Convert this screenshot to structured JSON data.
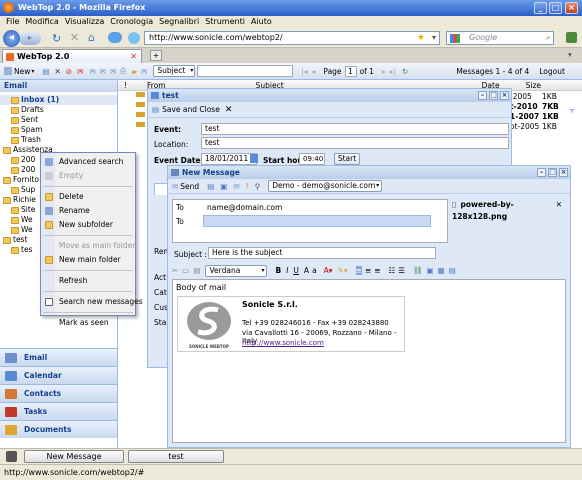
{
  "browser": {
    "title": "WebTop 2.0 - Mozilla Firefox",
    "menu": [
      "File",
      "Modifica",
      "Visualizza",
      "Cronologia",
      "Segnalibri",
      "Strumenti",
      "Aiuto"
    ],
    "url": "http://www.sonicle.com/webtop2/",
    "search_placeholder": "Google",
    "tab_label": "WebTop 2.0",
    "status_url": "http://www.sonicle.com/webtop2/#"
  },
  "toolbar": {
    "new_label": "New",
    "filter_value": "Subject",
    "page_label": "Page",
    "page_value": "1",
    "page_of": "of 1",
    "messages_info": "Messages 1 - 4 of 4",
    "logout_label": "Logout"
  },
  "sidebar": {
    "header": "Email",
    "tree": [
      {
        "label": "Inbox (1)",
        "indent": 1,
        "bold": true,
        "selected": true
      },
      {
        "label": "Drafts",
        "indent": 1
      },
      {
        "label": "Sent",
        "indent": 1
      },
      {
        "label": "Spam",
        "indent": 1
      },
      {
        "label": "Trash",
        "indent": 1
      },
      {
        "label": "Assistenza",
        "indent": 0
      },
      {
        "label": "200",
        "indent": 1
      },
      {
        "label": "200",
        "indent": 1
      },
      {
        "label": "Fornito",
        "indent": 0
      },
      {
        "label": "Sup",
        "indent": 1
      },
      {
        "label": "Richie",
        "indent": 0
      },
      {
        "label": "Site",
        "indent": 1
      },
      {
        "label": "We",
        "indent": 1
      },
      {
        "label": "We",
        "indent": 1
      },
      {
        "label": "test",
        "indent": 0
      },
      {
        "label": "tes",
        "indent": 1
      }
    ],
    "nav": [
      {
        "label": "Email",
        "icon": "email-icon",
        "color": "#6b8fd1"
      },
      {
        "label": "Calendar",
        "icon": "calendar-icon",
        "color": "#5b8bd6"
      },
      {
        "label": "Contacts",
        "icon": "contacts-icon",
        "color": "#d07a3a"
      },
      {
        "label": "Tasks",
        "icon": "tasks-icon",
        "color": "#c0392b"
      },
      {
        "label": "Documents",
        "icon": "documents-icon",
        "color": "#e0a730"
      }
    ]
  },
  "context_menu": {
    "items": [
      {
        "label": "Advanced search",
        "disabled": false,
        "icon": "search-icon"
      },
      {
        "label": "Empty",
        "disabled": true,
        "icon": "empty-icon"
      },
      {
        "sep": true
      },
      {
        "label": "Delete",
        "disabled": false,
        "icon": "folder-delete-icon"
      },
      {
        "label": "Rename",
        "disabled": false,
        "icon": "rename-icon"
      },
      {
        "label": "New subfolder",
        "disabled": false,
        "icon": "folder-add-icon"
      },
      {
        "sep": true
      },
      {
        "label": "Move as main folder",
        "disabled": true,
        "icon": ""
      },
      {
        "label": "New main folder",
        "disabled": false,
        "icon": "folder-icon"
      },
      {
        "sep": true
      },
      {
        "label": "Refresh",
        "disabled": false,
        "icon": ""
      },
      {
        "sep": true
      },
      {
        "label": "Search new messages",
        "disabled": false,
        "icon": "checkbox-icon"
      },
      {
        "sep": true
      },
      {
        "label": "Mark as seen",
        "disabled": false,
        "icon": ""
      }
    ]
  },
  "grid": {
    "col_from": "From",
    "col_subject": "Subject",
    "col_date": "Date",
    "col_size": "Size",
    "rows": [
      {
        "date": "-2005",
        "size": "1KB"
      },
      {
        "date": "t-2010",
        "size": "7KB"
      },
      {
        "date": "1-2007",
        "size": "1KB"
      },
      {
        "date": "ot-2005",
        "size": "1KB"
      }
    ]
  },
  "event_window": {
    "title": "test",
    "save_label": "Save and Close",
    "event_label": "Event:",
    "event_value": "test",
    "location_label": "Location:",
    "location_value": "test",
    "date_label": "Event Date:",
    "date_value": "18/01/2011",
    "start_hour_label": "Start hour",
    "start_hour_value": "09:40",
    "start_button": "Start",
    "side_labels": [
      "Rem",
      "Act",
      "Cat",
      "Cus",
      "Sta"
    ]
  },
  "compose": {
    "title": "New Message",
    "send_label": "Send",
    "from_value": "Demo - demo@sonicle.com",
    "to_label_1": "To",
    "to_value_1": "name@domain.com",
    "to_label_2": "To",
    "attachment": "powered-by-128x128.png",
    "subject_label": "Subject :",
    "subject_value": "Here is the subject",
    "font_value": "Verdana",
    "body_text": "Body of mail",
    "sig_company": "Sonicle S.r.l.",
    "sig_phone": "Tel +39 028246016 - Fax +39 028243880",
    "sig_address": "via Cavallotti 16 - 20069, Rozzano - Milano - Italy",
    "sig_url": "http://www.sonicle.com",
    "logo_text": "SONICLE WEBTOP"
  },
  "taskbar": {
    "btn1": "New Message",
    "btn2": "test"
  }
}
